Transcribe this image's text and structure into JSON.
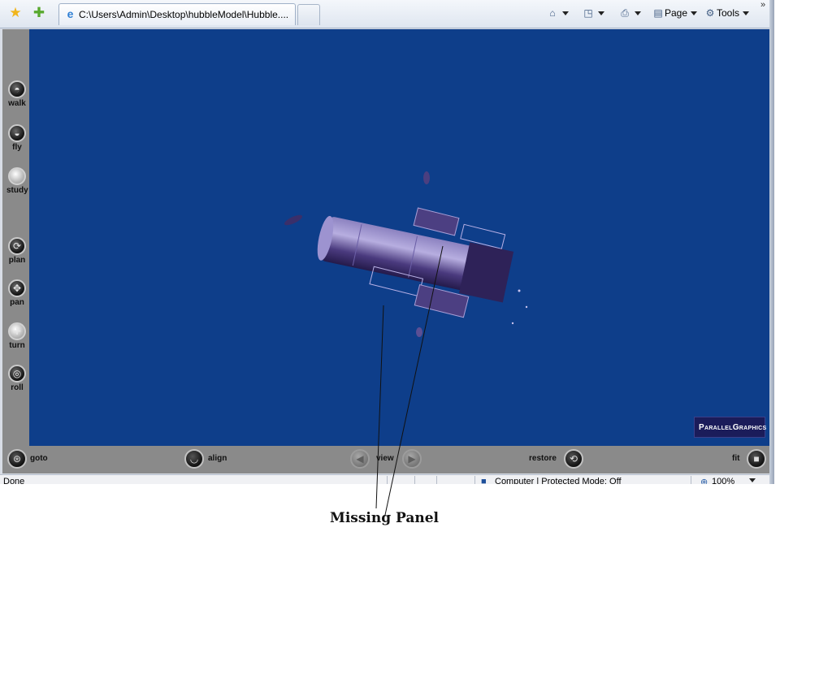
{
  "browser": {
    "tab_title": "C:\\Users\\Admin\\Desktop\\hubbleModel\\Hubble....",
    "commands": {
      "page": "Page",
      "tools": "Tools"
    },
    "chevron": "»"
  },
  "viewer": {
    "nav_buttons": [
      {
        "label": "walk",
        "icon": "walk-icon"
      },
      {
        "label": "fly",
        "icon": "fly-icon"
      },
      {
        "label": "study",
        "icon": "study-icon"
      },
      {
        "label": "plan",
        "icon": "plan-icon"
      },
      {
        "label": "pan",
        "icon": "pan-icon"
      },
      {
        "label": "turn",
        "icon": "turn-icon"
      },
      {
        "label": "roll",
        "icon": "roll-icon"
      }
    ],
    "bottom_buttons": {
      "goto": "goto",
      "align": "align",
      "view": "view",
      "restore": "restore",
      "fit": "fit"
    },
    "logo_text": "ParallelGraphics",
    "background_color": "#0e3e8a"
  },
  "status_bar": {
    "left": "Done",
    "zone": "Computer | Protected Mode: Off",
    "zoom": "100%"
  },
  "annotation": {
    "text": "Missing Panel"
  }
}
